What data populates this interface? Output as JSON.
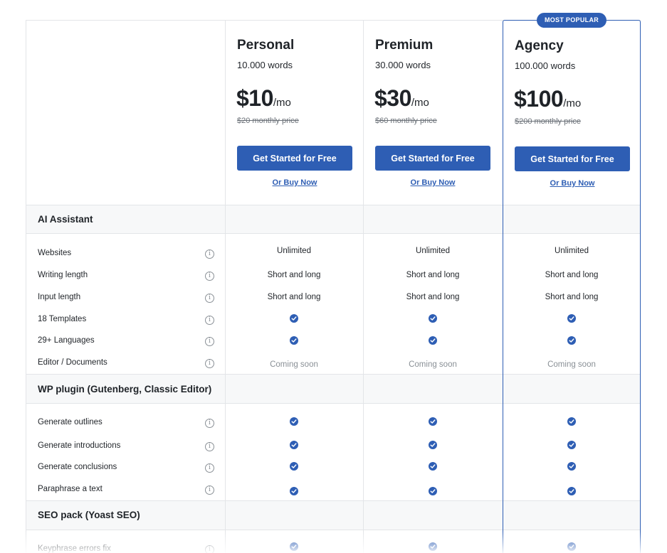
{
  "badge": "MOST POPULAR",
  "accent_color": "#2e5eb4",
  "plans": [
    {
      "name": "Personal",
      "words": "10.000 words",
      "price": "$10",
      "unit": "/mo",
      "old_price": "$20 monthly price",
      "cta": "Get Started for Free",
      "buy": "Or Buy Now"
    },
    {
      "name": "Premium",
      "words": "30.000 words",
      "price": "$30",
      "unit": "/mo",
      "old_price": "$60 monthly price",
      "cta": "Get Started for Free",
      "buy": "Or Buy Now"
    },
    {
      "name": "Agency",
      "words": "100.000 words",
      "price": "$100",
      "unit": "/mo",
      "old_price": "$200 monthly price",
      "cta": "Get Started for Free",
      "buy": "Or Buy Now"
    }
  ],
  "sections": [
    {
      "title": "AI Assistant"
    },
    {
      "title": "WP plugin (Gutenberg, Classic Editor)"
    },
    {
      "title": "SEO pack (Yoast SEO)"
    }
  ],
  "features": [
    {
      "label": "Websites",
      "values": [
        "Unlimited",
        "Unlimited",
        "Unlimited"
      ]
    },
    {
      "label": "Writing length",
      "values": [
        "Short and long",
        "Short and long",
        "Short and long"
      ]
    },
    {
      "label": "Input length",
      "values": [
        "Short and long",
        "Short and long",
        "Short and long"
      ]
    },
    {
      "label": "18 Templates",
      "values": [
        "check",
        "check",
        "check"
      ]
    },
    {
      "label": "29+ Languages",
      "values": [
        "check",
        "check",
        "check"
      ]
    },
    {
      "label": "Editor / Documents",
      "values": [
        "Coming soon",
        "Coming soon",
        "Coming soon"
      ]
    },
    {
      "label": "Generate outlines",
      "values": [
        "check",
        "check",
        "check"
      ]
    },
    {
      "label": "Generate introductions",
      "values": [
        "check",
        "check",
        "check"
      ]
    },
    {
      "label": "Generate conclusions",
      "values": [
        "check",
        "check",
        "check"
      ]
    },
    {
      "label": "Paraphrase a text",
      "values": [
        "check",
        "check",
        "check"
      ]
    },
    {
      "label": "Keyphrase errors fix",
      "values": [
        "check",
        "check",
        "check"
      ]
    }
  ],
  "icons": {
    "info": "info-circle-icon",
    "check": "check-circle-icon"
  },
  "info_glyph": "i"
}
